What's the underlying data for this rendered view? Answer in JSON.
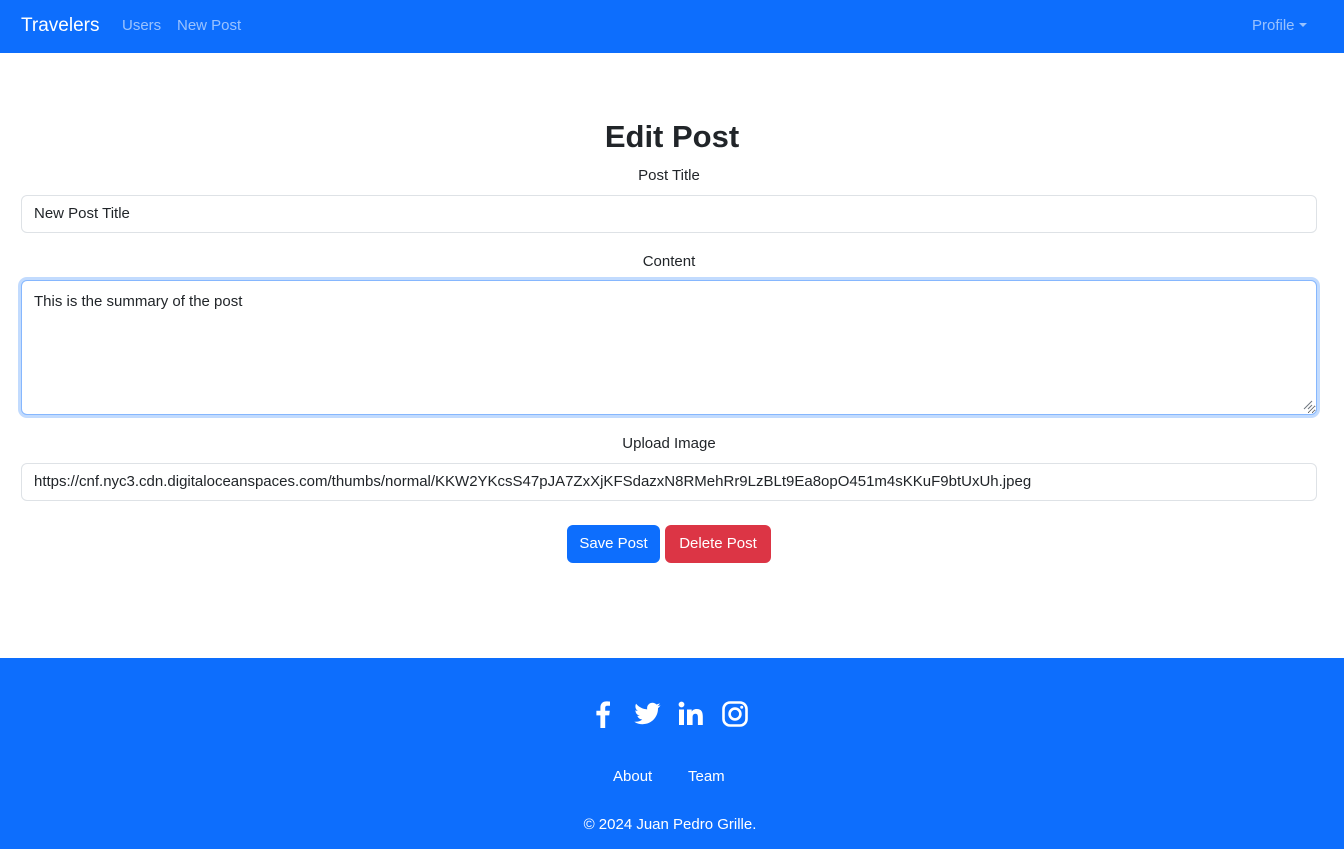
{
  "navbar": {
    "brand": "Travelers",
    "links": [
      "Users",
      "New Post"
    ],
    "profile": "Profile"
  },
  "form": {
    "heading": "Edit Post",
    "title_label": "Post Title",
    "title_value": "New Post Title",
    "content_label": "Content",
    "content_value": "This is the summary of the post",
    "image_label": "Upload Image",
    "image_value": "https://cnf.nyc3.cdn.digitaloceanspaces.com/thumbs/normal/KKW2YKcsS47pJA7ZxXjKFSdazxN8RMehRr9LzBLt9Ea8opO451m4sKKuF9btUxUh.jpeg",
    "save_label": "Save Post",
    "delete_label": "Delete Post"
  },
  "footer": {
    "social": [
      "facebook-icon",
      "twitter-icon",
      "linkedin-icon",
      "instagram-icon"
    ],
    "links": [
      "About",
      "Team"
    ],
    "copyright": "© 2024 Juan Pedro Grille."
  },
  "colors": {
    "primary": "#0d6efd",
    "danger": "#dc3545",
    "text": "#212529",
    "nav_link": "rgba(255,255,255,0.55)"
  }
}
